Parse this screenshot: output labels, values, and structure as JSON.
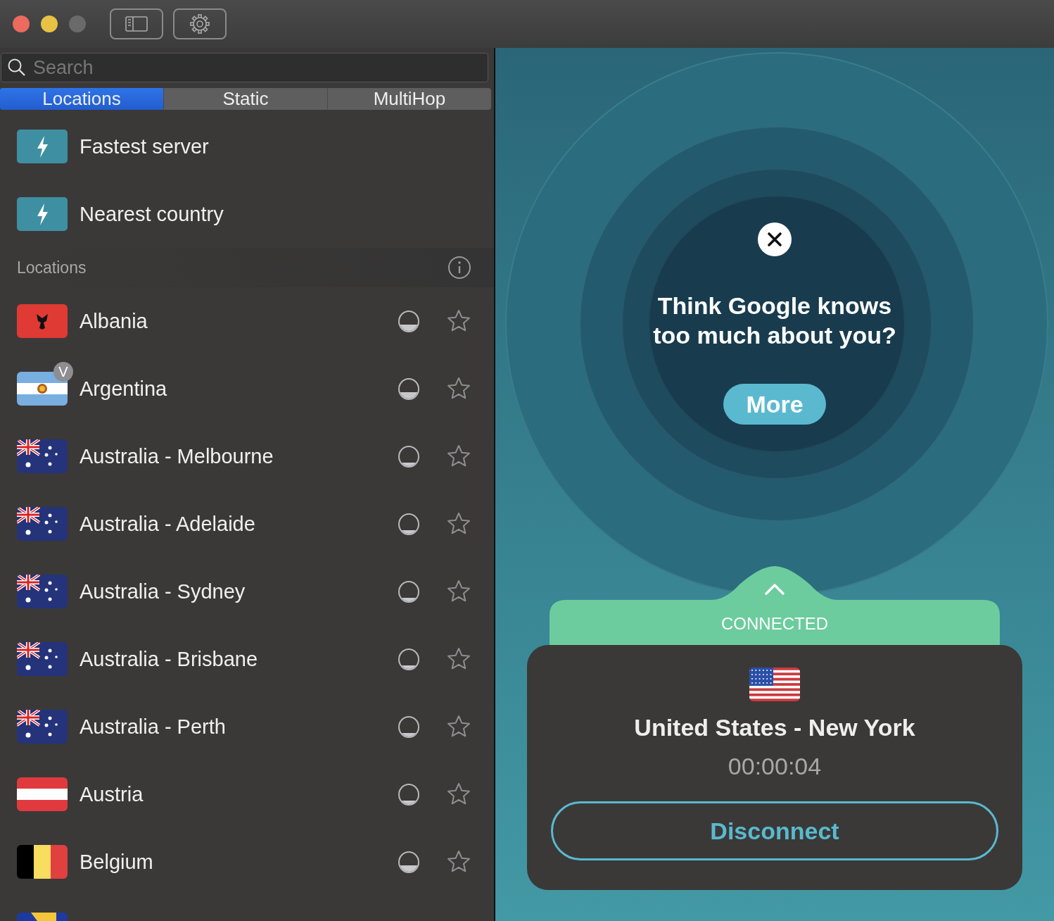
{
  "toolbar": {
    "zoom_disabled": true
  },
  "search": {
    "placeholder": "Search"
  },
  "tabs": [
    {
      "label": "Locations",
      "selected": true
    },
    {
      "label": "Static",
      "selected": false
    },
    {
      "label": "MultiHop",
      "selected": false
    }
  ],
  "quick_connect": [
    {
      "label": "Fastest server"
    },
    {
      "label": "Nearest country"
    }
  ],
  "section": {
    "title": "Locations"
  },
  "locations": [
    {
      "name": "Albania",
      "kind": "al",
      "level": 0.3,
      "favorite": false
    },
    {
      "name": "Argentina",
      "kind": "ar",
      "badge": "V",
      "level": 0.3,
      "favorite": false
    },
    {
      "name": "Australia - Melbourne",
      "kind": "au",
      "level": 0.18,
      "favorite": false
    },
    {
      "name": "Australia - Adelaide",
      "kind": "au",
      "level": 0.15,
      "favorite": false
    },
    {
      "name": "Australia - Sydney",
      "kind": "au",
      "level": 0.15,
      "favorite": false
    },
    {
      "name": "Australia - Brisbane",
      "kind": "au",
      "level": 0.15,
      "favorite": false
    },
    {
      "name": "Australia - Perth",
      "kind": "au",
      "level": 0.15,
      "favorite": false
    },
    {
      "name": "Austria",
      "kind": "at",
      "level": 0.15,
      "favorite": false
    },
    {
      "name": "Belgium",
      "kind": "be",
      "level": 0.3,
      "favorite": false
    },
    {
      "kind": "ba"
    }
  ],
  "promo": {
    "headline": "Think Google knows too much about you?",
    "button": "More"
  },
  "status": {
    "label": "CONNECTED",
    "connected": true
  },
  "connection": {
    "kind": "us",
    "location": "United States - New York",
    "duration": "00:00:04",
    "button": "Disconnect"
  }
}
